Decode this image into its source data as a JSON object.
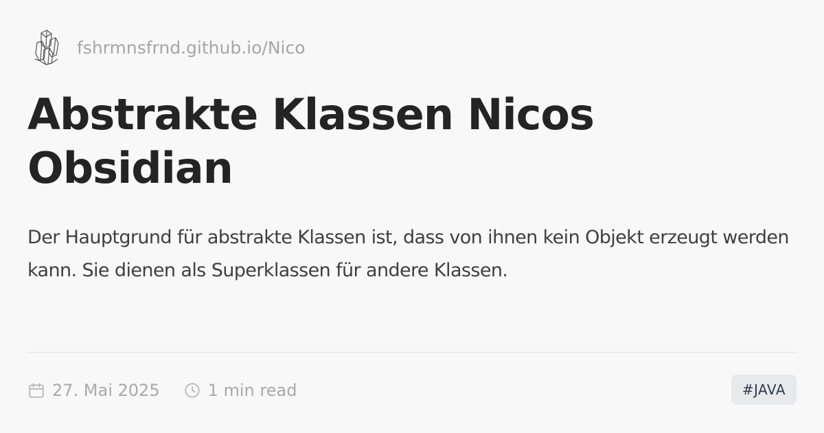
{
  "site": {
    "logo_icon": "crystal-logo-icon",
    "url": "fshrmnsfrnd.github.io/Nico"
  },
  "post": {
    "title": "Abstrakte Klassen Nicos Obsidian",
    "description": "Der Hauptgrund für abstrakte Klassen ist, dass von ihnen kein Objekt erzeugt werden kann. Sie dienen als Superklassen für andere Klassen."
  },
  "meta": {
    "date_icon": "calendar-icon",
    "date": "27. Mai 2025",
    "reading_icon": "clock-icon",
    "reading_time": "1 min read"
  },
  "tags": [
    "#JAVA"
  ]
}
